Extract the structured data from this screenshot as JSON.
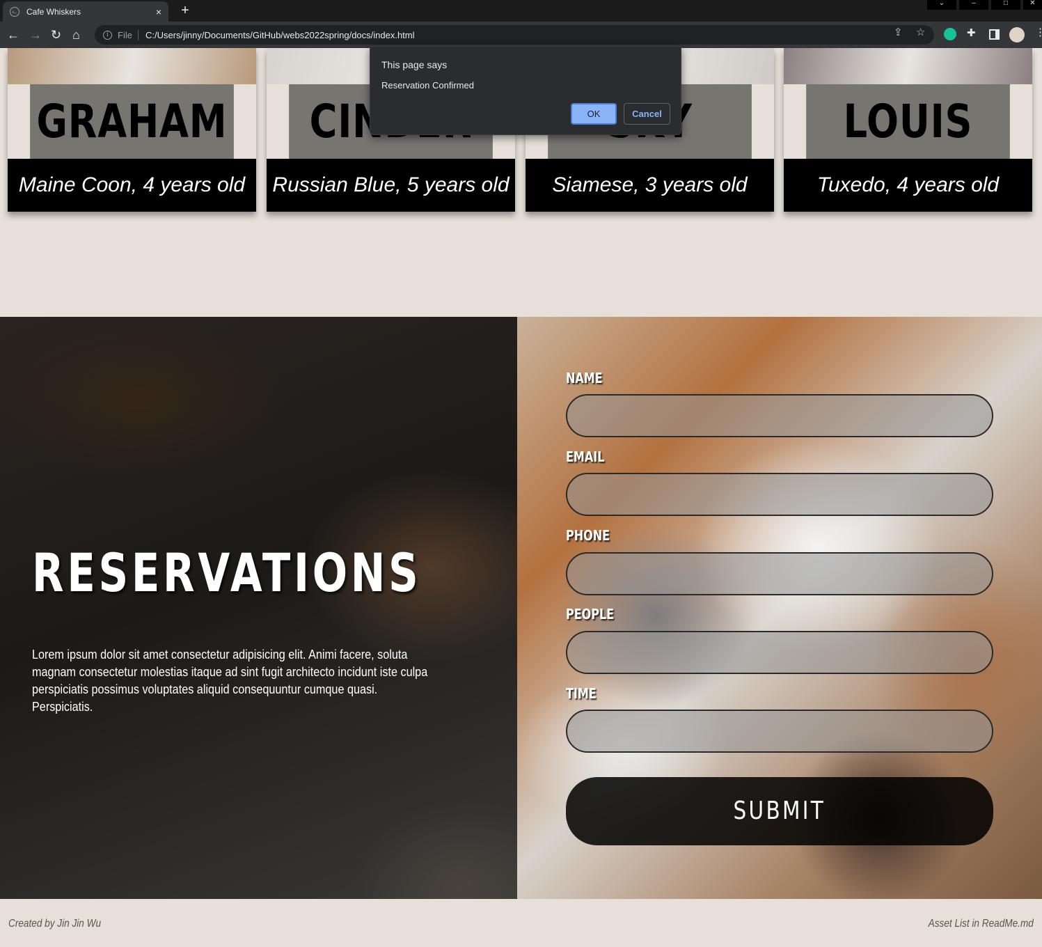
{
  "browser": {
    "tab_title": "Cafe Whiskers",
    "tab_close": "×",
    "new_tab": "+",
    "scheme": "File",
    "url": "C:/Users/jinny/Documents/GitHub/webs2022spring/docs/index.html"
  },
  "cats": [
    {
      "name": "GRAHAM",
      "description": "Maine Coon, 4 years old",
      "photo_color": "#b89a7c"
    },
    {
      "name": "CINDER",
      "description": "Russian Blue, 5 years old",
      "photo_color": "#d7d3cf"
    },
    {
      "name": "SKY",
      "description": "Siamese, 3 years old",
      "photo_color": "#cfcac6"
    },
    {
      "name": "LOUIS",
      "description": "Tuxedo, 4 years old",
      "photo_color": "#8c7f80"
    }
  ],
  "dialog": {
    "title": "This page says",
    "message": "Reservation Confirmed",
    "ok_label": "OK",
    "cancel_label": "Cancel"
  },
  "reservations": {
    "title": "RESERVATIONS",
    "body": "Lorem ipsum dolor sit amet consectetur adipisicing elit. Animi facere, soluta magnam consectetur molestias itaque ad sint fugit architecto incidunt iste culpa perspiciatis possimus voluptates aliquid consequuntur cumque quasi. Perspiciatis.",
    "fields": {
      "name": "NAME",
      "email": "EMAIL",
      "phone": "PHONE",
      "people": "PEOPLE",
      "time": "TIME"
    },
    "submit_label": "SUBMIT"
  },
  "footer": {
    "credit": "Created by Jin Jin Wu",
    "assets": "Asset List in ReadMe.md"
  }
}
